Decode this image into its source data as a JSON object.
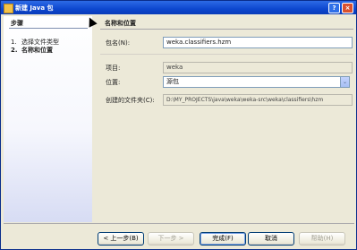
{
  "window": {
    "title": "新建 Java 包",
    "help_glyph": "?",
    "close_glyph": "×"
  },
  "steps": {
    "heading": "步骤",
    "items": [
      {
        "num": "1.",
        "label": "选择文件类型"
      },
      {
        "num": "2.",
        "label": "名称和位置"
      }
    ]
  },
  "panel": {
    "title": "名称和位置",
    "package_name": {
      "label": "包名(N):",
      "value": "weka.classifiers.hzm"
    },
    "project": {
      "label": "项目:",
      "value": "weka"
    },
    "location": {
      "label": "位置:",
      "value": "源包",
      "dropdown_glyph": "⌄"
    },
    "created_folder": {
      "label": "创建的文件夹(C):",
      "value": "D:\\MY_PROJECTS\\java\\weka\\weka-src\\weka\\classifiers\\hzm"
    }
  },
  "buttons": {
    "back": "< 上一步(B)",
    "next": "下一步 >",
    "finish": "完成(F)",
    "cancel": "取消",
    "help": "帮助(H)"
  }
}
